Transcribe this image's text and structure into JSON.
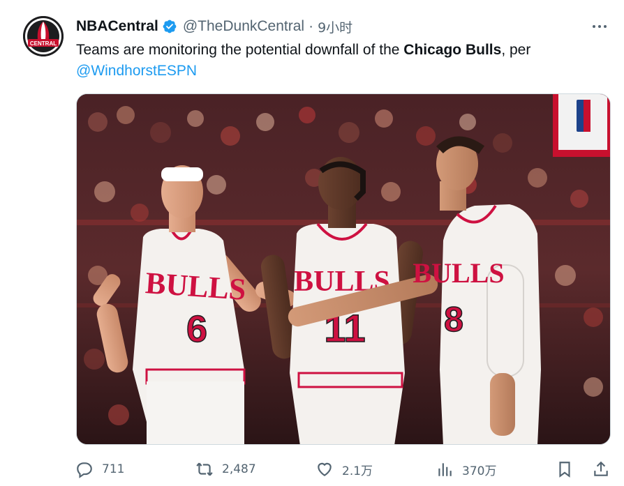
{
  "tweet": {
    "display_name": "NBACentral",
    "verified": true,
    "handle": "@TheDunkCentral",
    "separator": "·",
    "time": "9小时",
    "text_before": "Teams are monitoring the potential downfall of the ",
    "text_bold": "Chicago Bulls",
    "text_after": ", per ",
    "mention": "@WindhorstESPN",
    "avatar_label": "CENTRAL"
  },
  "media": {
    "jersey_team": "BULLS",
    "players": [
      {
        "number": "6"
      },
      {
        "number": "11"
      },
      {
        "number": "8"
      }
    ]
  },
  "actions": {
    "replies": "711",
    "retweets": "2,487",
    "likes": "2.1万",
    "views": "370万"
  },
  "colors": {
    "accent": "#1d9bf0",
    "bulls_red": "#ce1141",
    "secondary_text": "#536471"
  }
}
